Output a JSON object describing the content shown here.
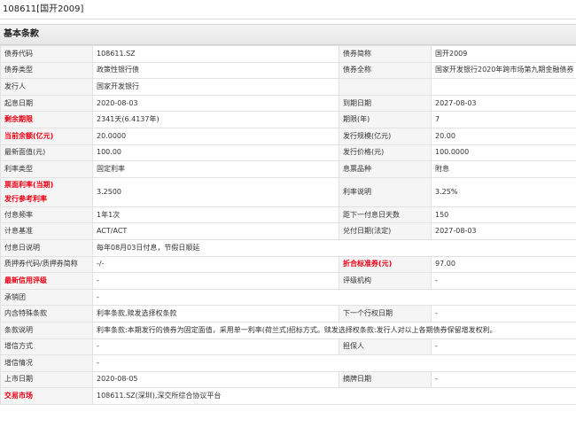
{
  "title": "108611[国开2009]",
  "section": "基本条款",
  "rows": [
    {
      "k1": "债券代码",
      "v1": "108611.SZ",
      "k2": "债券简称",
      "v2": "国开2009"
    },
    {
      "k1": "债券类型",
      "v1": "政策性银行债",
      "k2": "债券全称",
      "v2": "国家开发银行2020年跨市场第九期金融债券"
    },
    {
      "k1": "发行人",
      "v1": "国家开发银行",
      "k2": "",
      "v2": ""
    },
    {
      "k1": "起息日期",
      "v1": "2020-08-03",
      "k2": "到期日期",
      "v2": "2027-08-03"
    },
    {
      "k1": "剩余期限",
      "v1": "2341天(6.4137年)",
      "k2": "期限(年)",
      "v2": "7"
    },
    {
      "k1": "当前余额(亿元)",
      "v1": "20.0000",
      "k2": "发行规模(亿元)",
      "v2": "20.00"
    },
    {
      "k1": "最新面值(元)",
      "v1": "100.00",
      "k2": "发行价格(元)",
      "v2": "100.0000"
    },
    {
      "k1": "利率类型",
      "v1": "固定利率",
      "k2": "息票品种",
      "v2": "附息"
    },
    {
      "k1a": "票面利率(当期)",
      "k1b": "发行参考利率",
      "v1": "3.2500",
      "k2": "利率说明",
      "v2": "3.25%"
    },
    {
      "k1": "付息频率",
      "v1": "1年1次",
      "k2": "距下一付息日天数",
      "v2": "150"
    },
    {
      "k1": "计息基准",
      "v1": "ACT/ACT",
      "k2": "兑付日期(法定)",
      "v2": "2027-08-03"
    },
    {
      "k1": "付息日说明",
      "v1": "每年08月03日付息，节假日顺延"
    },
    {
      "k1": "质押券代码/质押券简称",
      "v1": "-/-",
      "k2": "折合标准券(元)",
      "v2": "97.00"
    },
    {
      "k1": "最新信用评级",
      "v1": "-",
      "k2": "评级机构",
      "v2": "-"
    },
    {
      "k1": "承销团",
      "v1": "-"
    },
    {
      "k1": "内含特殊条款",
      "v1": "利率条款,赎发选择权条款",
      "k2": "下一个行权日期",
      "v2": "-"
    },
    {
      "k1": "条款说明",
      "v1": "利率条款:本期发行的债券为固定面值，采用单一利率(荷兰式)招标方式。赎发选择权条款:发行人对以上各期债券保留增发权利。"
    },
    {
      "k1": "增信方式",
      "v1": "-",
      "k2": "担保人",
      "v2": "-"
    },
    {
      "k1": "增信情况",
      "v1": "-"
    },
    {
      "k1": "上市日期",
      "v1": "2020-08-05",
      "k2": "摘牌日期",
      "v2": "-"
    },
    {
      "k1": "交易市场",
      "v1": "108611.SZ(深圳),深交所综合协议平台"
    }
  ]
}
